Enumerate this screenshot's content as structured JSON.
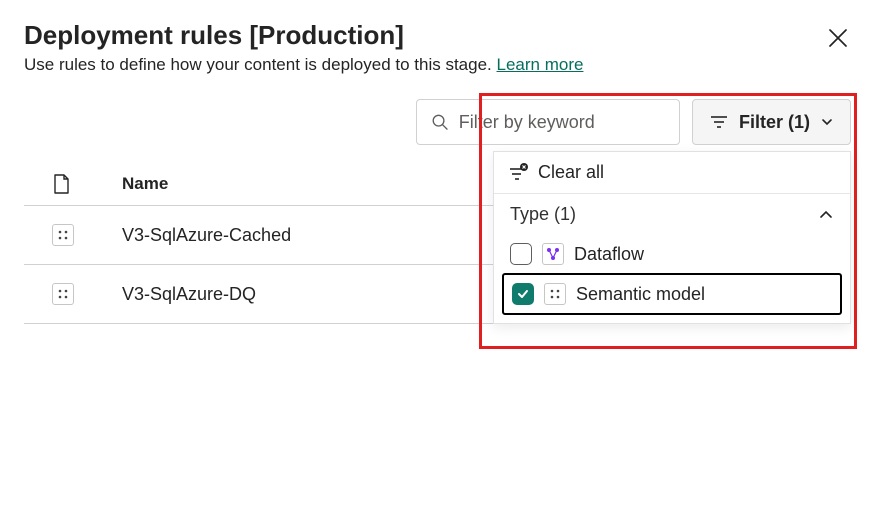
{
  "header": {
    "title": "Deployment rules [Production]",
    "subtitle": "Use rules to define how your content is deployed to this stage.",
    "learn_more": "Learn more"
  },
  "toolbar": {
    "search_placeholder": "Filter by keyword",
    "filter_label": "Filter (1)"
  },
  "filter_panel": {
    "clear_label": "Clear all",
    "type_header": "Type (1)",
    "options": [
      {
        "label": "Dataflow",
        "checked": false
      },
      {
        "label": "Semantic model",
        "checked": true
      }
    ]
  },
  "table": {
    "name_header": "Name",
    "rows": [
      {
        "name": "V3-SqlAzure-Cached"
      },
      {
        "name": "V3-SqlAzure-DQ"
      }
    ]
  },
  "colors": {
    "accent": "#0f7b6c",
    "highlight": "#e02020"
  }
}
